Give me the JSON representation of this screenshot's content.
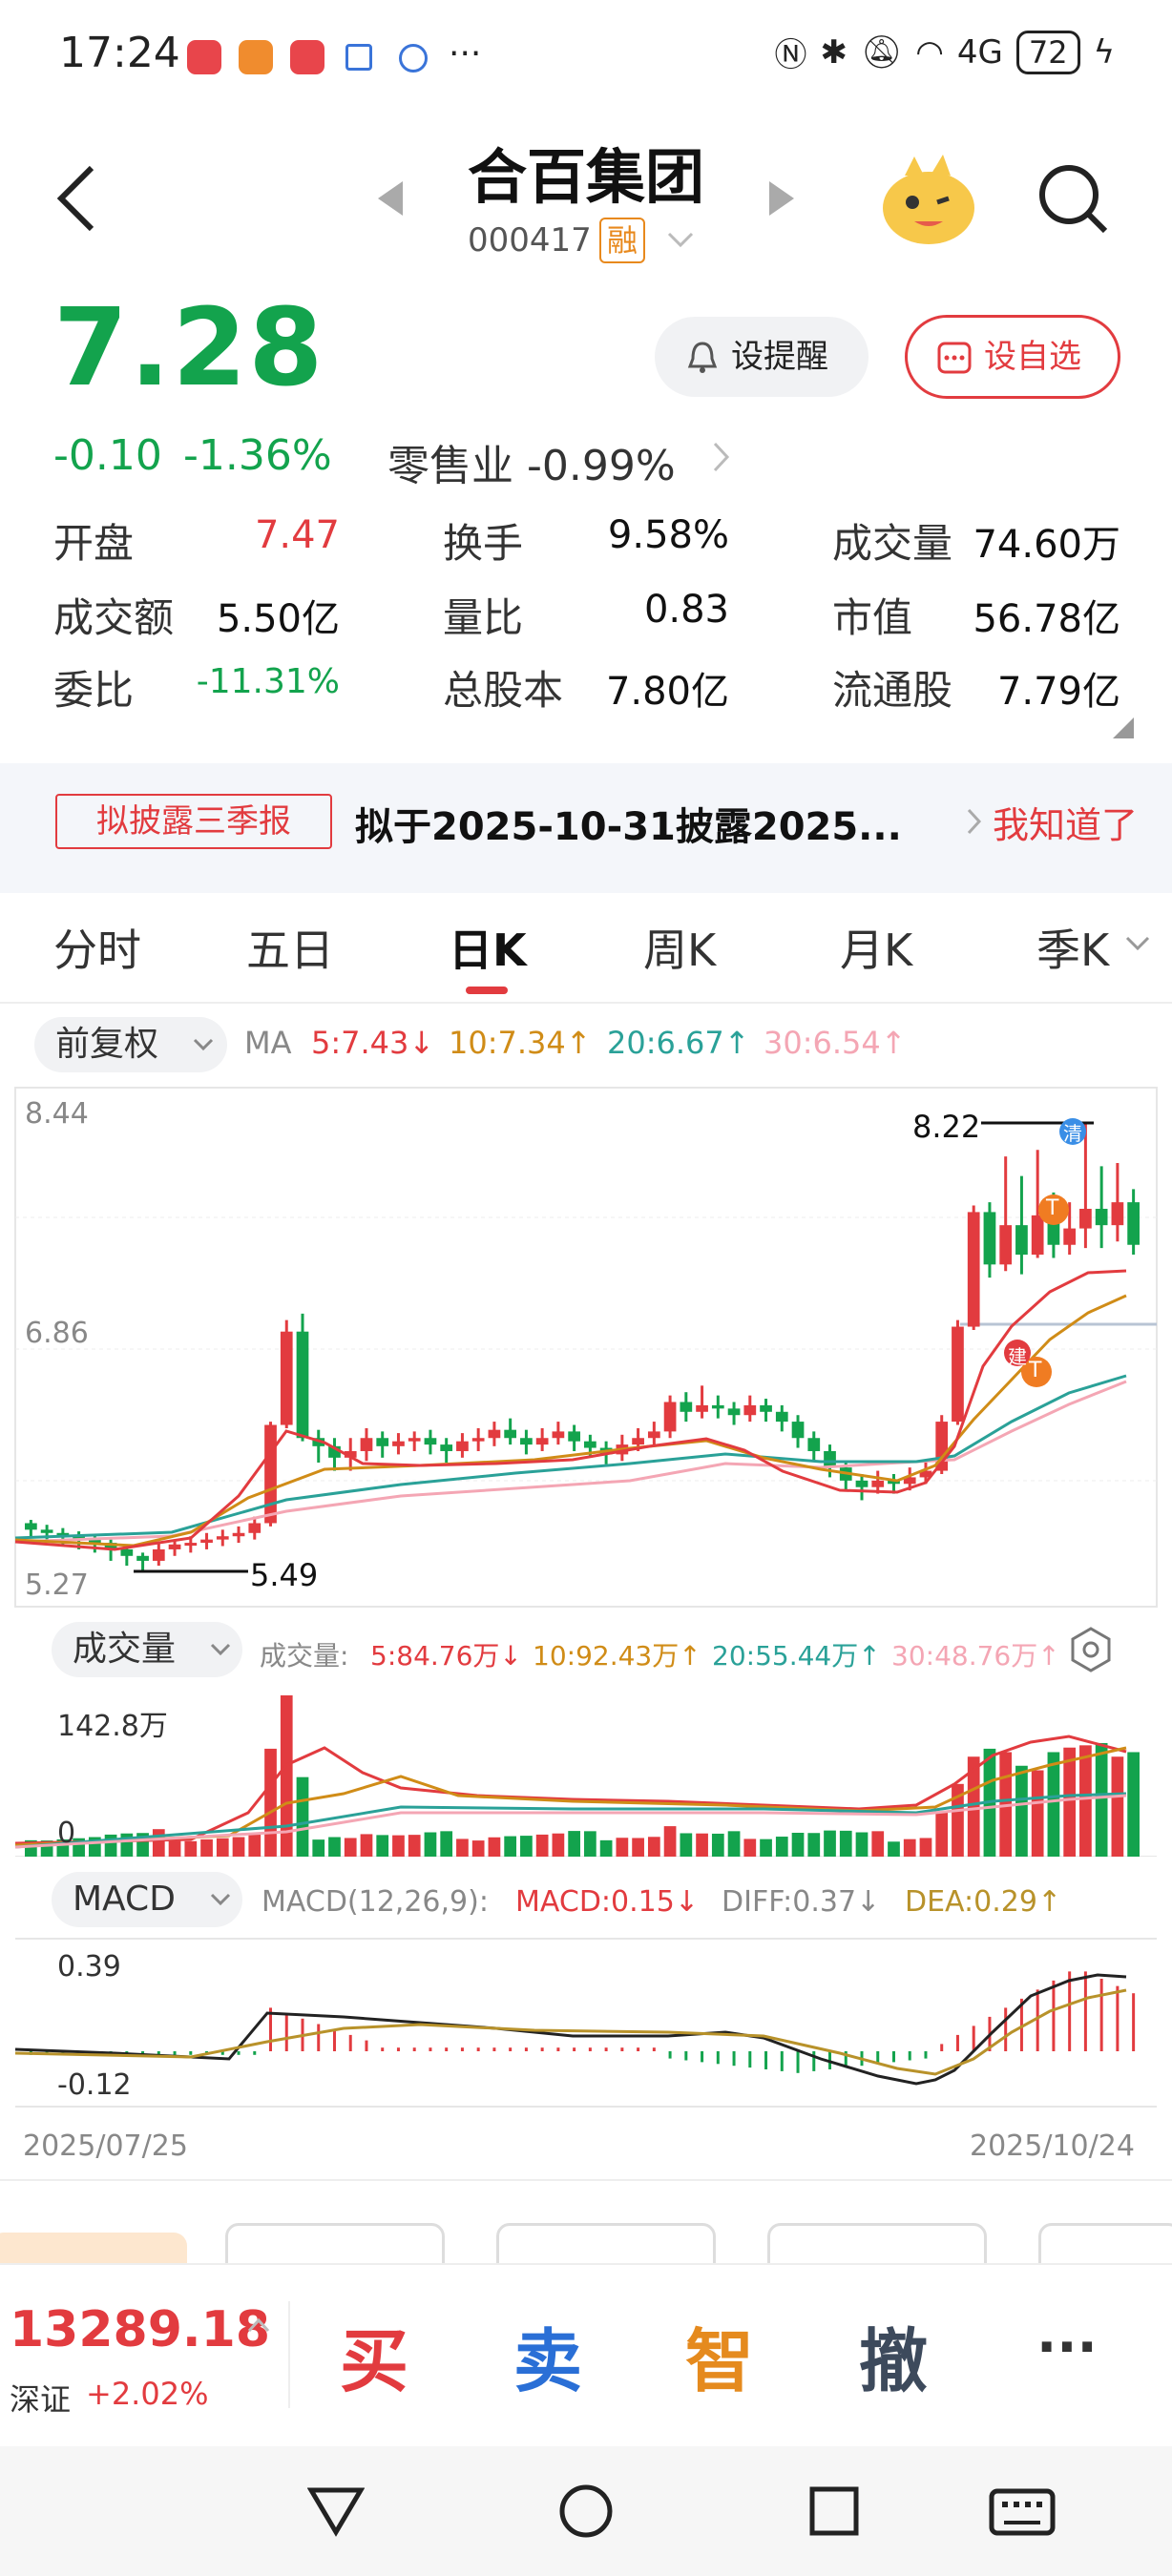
{
  "status_bar": {
    "time": "17:24",
    "battery": "72",
    "network": "4G"
  },
  "header": {
    "title": "合百集团",
    "code": "000417",
    "margin_badge": "融"
  },
  "quote": {
    "price": "7.28",
    "change": "-0.10",
    "change_pct": "-1.36%",
    "industry": "零售业 -0.99%",
    "remind_label": "设提醒",
    "fav_label": "设自选"
  },
  "stats": [
    {
      "label": "开盘",
      "value": "7.47"
    },
    {
      "label": "换手",
      "value": "9.58%"
    },
    {
      "label": "成交量",
      "value": "74.60万"
    },
    {
      "label": "成交额",
      "value": "5.50亿"
    },
    {
      "label": "量比",
      "value": "0.83"
    },
    {
      "label": "市值",
      "value": "56.78亿"
    },
    {
      "label": "委比",
      "value": "-11.31%"
    },
    {
      "label": "总股本",
      "value": "7.80亿"
    },
    {
      "label": "流通股",
      "value": "7.79亿"
    }
  ],
  "banner": {
    "tag": "拟披露三季报",
    "text": "拟于2025-10-31披露2025...",
    "action": "我知道了"
  },
  "tabs": [
    "分时",
    "五日",
    "日K",
    "周K",
    "月K",
    "季K"
  ],
  "kline": {
    "adjust": "前复权",
    "ma_label": "MA",
    "ma5": "5:7.43↓",
    "ma10": "10:7.34↑",
    "ma20": "20:6.67↑",
    "ma30": "30:6.54↑",
    "y_top": "8.44",
    "y_mid": "6.86",
    "y_bottom": "5.27",
    "high_label": "8.22",
    "low_label": "5.49",
    "mark_qing": "清",
    "mark_t": "T",
    "mark_jian": "建"
  },
  "volume": {
    "pill": "成交量",
    "legend_label": "成交量:",
    "v5": "5:84.76万↓",
    "v10": "10:92.43万↑",
    "v20": "20:55.44万↑",
    "v30": "30:48.76万↑",
    "y_top": "142.8万",
    "y_zero": "0"
  },
  "macd": {
    "pill": "MACD",
    "params": "MACD(12,26,9):",
    "macd": "MACD:0.15↓",
    "diff": "DIFF:0.37↓",
    "dea": "DEA:0.29↑",
    "y_top": "0.39",
    "y_bottom": "-0.12"
  },
  "dates": {
    "start": "2025/07/25",
    "end": "2025/10/24"
  },
  "index": {
    "value": "13289.18",
    "name": "深证",
    "pct": "+2.02%"
  },
  "actions": {
    "buy": "买",
    "sell": "卖",
    "smart": "智",
    "cancel": "撤",
    "more": "···"
  },
  "colors": {
    "up": "#e23b3f",
    "down": "#13a34d",
    "ma5": "#e23b3f",
    "ma10": "#d08c17",
    "ma20": "#2aa198",
    "ma30": "#f4a6b4"
  }
}
